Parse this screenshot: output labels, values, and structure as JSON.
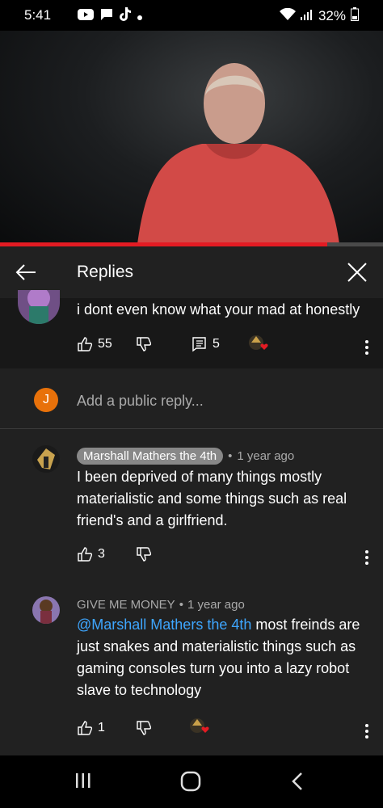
{
  "status_bar": {
    "time": "5:41",
    "battery": "32%",
    "icons": [
      "youtube-icon",
      "chat-icon",
      "tiktok-icon",
      "dot-icon",
      "wifi-icon",
      "signal-icon",
      "battery-icon"
    ]
  },
  "video": {
    "progress_fraction": 0.855
  },
  "replies_panel": {
    "title": "Replies",
    "parent_comment": {
      "text": "i dont even know what your mad at honestly",
      "likes": "55",
      "replies": "5"
    },
    "reply_box": {
      "avatar_letter": "J",
      "placeholder": "Add a public reply..."
    },
    "comments": [
      {
        "author": "Marshall Mathers the 4th",
        "time": "1 year ago",
        "text": "I been deprived of many things mostly materialistic and some things such as real friend's and a girlfriend.",
        "likes": "3"
      },
      {
        "author": "GIVE ME MONEY",
        "time": "1 year ago",
        "mention": "@Marshall Mathers the 4th",
        "text": " most freinds are just snakes and materialistic things such as gaming consoles turn you into a lazy robot slave to technology",
        "likes": "1"
      }
    ]
  },
  "colors": {
    "accent_red": "#e31b23",
    "mention_blue": "#3ea6ff",
    "avatar_orange": "#e8710a",
    "panel_bg": "#212121"
  }
}
